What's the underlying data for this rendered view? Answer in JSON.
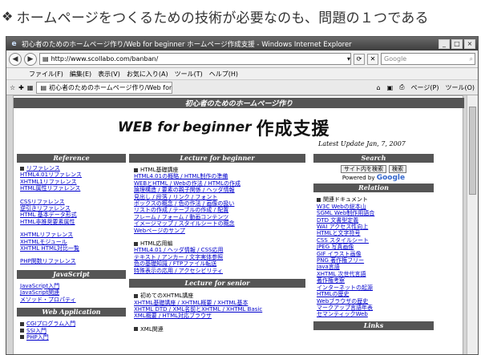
{
  "caption": {
    "bullet": "❖",
    "text": "ホームページをつくるための技術が必要なのも、問題の１つである"
  },
  "browser": {
    "title": "初心者のためのホームページ作り/Web for beginner ホームページ作成支援 - Windows Internet Explorer",
    "url": "http://www.scollabo.com/banban/",
    "search_placeholder": "Google",
    "menu": [
      "ファイル(F)",
      "編集(E)",
      "表示(V)",
      "お気に入り(A)",
      "ツール(T)",
      "ヘルプ(H)"
    ],
    "tab_label": "初心者のためのホームページ作り/Web for beginner ホ...",
    "tools": [
      "ページ(P)",
      "ツール(O)"
    ],
    "window_buttons": [
      "_",
      "□",
      "×"
    ]
  },
  "site": {
    "title": "初心者のためのホームページ作り",
    "logo_web": "WEB for",
    "logo_beginner": "beginner",
    "logo_jp": "作成支援",
    "update": "Latest Update  Jan, 7, 2007"
  },
  "left": {
    "reference_head": "Reference",
    "reference_links": [
      "リファレンス",
      "HTML4.01リファレンス",
      "XHTML1リファレンス",
      "HTML属性リファレンス"
    ],
    "css_links": [
      "CSSリファレンス",
      "逆引きリファレンス",
      "HTML 基本データ形式",
      "HTML非推奨要素属性"
    ],
    "xhtml_links": [
      "XHTMLリファレンス",
      "XHTMLモジュール",
      "XHTML HTML対比一覧"
    ],
    "php_links": [
      "PHP関数リファレンス"
    ],
    "javascript_head": "JavaScript",
    "javascript_links": [
      "JavaScript入門",
      "JavaScript関連",
      "メソッド・プロパティ"
    ],
    "webapp_head": "Web Application",
    "webapp_links": [
      "CGIプログラム入門",
      "SSI入門",
      "PHP入門"
    ]
  },
  "center": {
    "lecture_head": "Lecture for beginner",
    "html_basic_head": "HTML基礎講座",
    "html_basic_lines": [
      "HTML4.01の概略 / HTML制作の準備",
      "WEBとHTML / Webの作法 / HTMLの作成",
      "論理構造 / 要素の親子関係 / ヘッダ情報",
      "見出し / 段落 / リンク / フォント",
      "ボックスの概念 / 色の作法 / 画像の扱い",
      "リストの作成 / テーブルの作成 / 配置",
      "フレーム / フォーム / 動画コンテンツ",
      "イメージマップ / スタイルシートの概念",
      "Webページのサンプ"
    ],
    "html_app_head": "HTML応用編",
    "html_app_lines": [
      "HTML4.01 / ヘッダ情報 / CSS応用",
      "テキスト / アンカー / 文字実体参照",
      "色の基礎知識 / FTPファイル転送",
      "特殊表示の応用 / アクセシビリティ"
    ],
    "senior_head": "Lecture for senior",
    "xhtml_head": "初めてのXHTML講座",
    "xhtml_lines": [
      "XHTML基礎講座 / XHTML概要 / XHTML基本",
      "XHTML DTD / XML名前とXHTML / XHTML Basic",
      "XML概要 / HTML対応ブラウザ"
    ],
    "xml_head": "XML関連"
  },
  "right": {
    "search_head": "Search",
    "search_btn1": "サイト内を検索",
    "search_btn2": "検索",
    "powered_by": "Powered by",
    "google": "Google",
    "relation_head": "Relation",
    "relation_bullet": "関連ドキュメント",
    "relation_links": [
      "W3C Webの総本山",
      "SGML Web制作用語合",
      "DTD 文書型定義",
      "WAI アクセス性向上",
      "HTMLと文字符号",
      "CSS スタイルシート",
      "JPEG 写真画像",
      "GIF イラスト画像",
      "PNG 著作権フリー",
      "Java言語",
      "XHTML 次世代言語",
      "著作権考察",
      "インターネットの起源",
      "HTMLの歴史",
      "Webブラウザの歴史",
      "マークアップ言語年表",
      "セマンティックWeb"
    ],
    "links_head": "Links"
  }
}
